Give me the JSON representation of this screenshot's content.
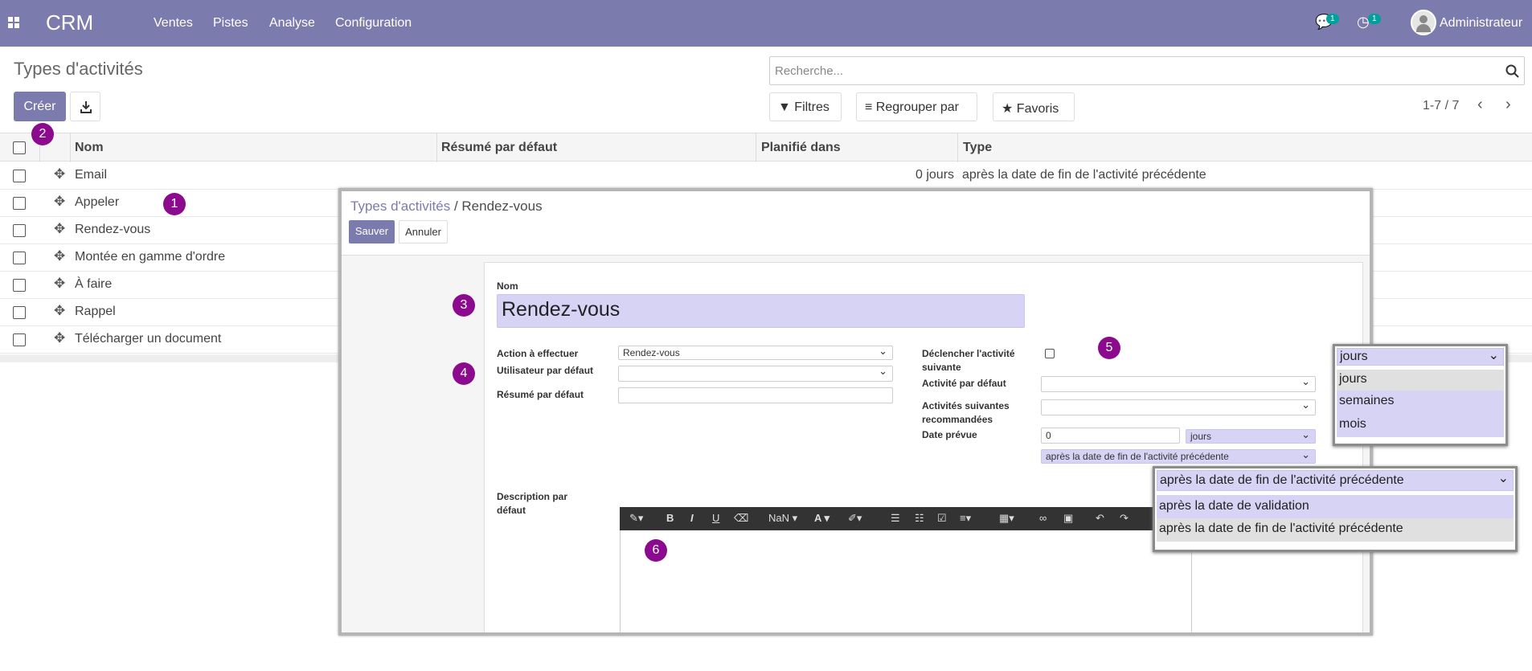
{
  "nav": {
    "brand": "CRM",
    "menu": [
      "Ventes",
      "Pistes",
      "Analyse",
      "Configuration"
    ],
    "messages_badge": "1",
    "activities_badge": "1",
    "user": "Administrateur"
  },
  "page": {
    "title": "Types d'activités",
    "create_label": "Créer",
    "search_placeholder": "Recherche...",
    "filters": "Filtres",
    "group_by": "Regrouper par",
    "favorites": "Favoris",
    "pager": "1-7 / 7"
  },
  "list": {
    "columns": [
      "Nom",
      "Résumé par défaut",
      "Planifié dans",
      "Type"
    ],
    "rows": [
      {
        "name": "Email",
        "planned": "0 jours",
        "type": "après la date de fin de l'activité précédente"
      },
      {
        "name": "Appeler"
      },
      {
        "name": "Rendez-vous"
      },
      {
        "name": "Montée en gamme d'ordre"
      },
      {
        "name": "À faire"
      },
      {
        "name": "Rappel"
      },
      {
        "name": "Télécharger un document"
      }
    ]
  },
  "markers": [
    "1",
    "2",
    "3",
    "4",
    "5",
    "6"
  ],
  "dialog": {
    "breadcrumb_parent": "Types d'activités",
    "breadcrumb_sep": "/",
    "breadcrumb_current": "Rendez-vous",
    "save": "Sauver",
    "cancel": "Annuler",
    "name_label": "Nom",
    "name_value": "Rendez-vous",
    "action_label": "Action à effectuer",
    "action_value": "Rendez-vous",
    "user_label": "Utilisateur par défaut",
    "summary_label": "Résumé par défaut",
    "trigger_label": "Déclencher l'activité suivante",
    "default_activity_label": "Activité par défaut",
    "recommended_label": "Activités suivantes recommandées",
    "date_label": "Date prévue",
    "date_value": "0",
    "date_unit": "jours",
    "date_ref": "après la date de fin de l'activité précédente",
    "description_label": "Description par défaut",
    "font_size": "NaN"
  },
  "unit_dropdown": {
    "selected": "jours",
    "options": [
      "jours",
      "semaines",
      "mois"
    ]
  },
  "ref_dropdown": {
    "selected": "après la date de fin de l'activité précédente",
    "options": [
      "après la date de validation",
      "après la date de fin de l'activité précédente"
    ]
  }
}
